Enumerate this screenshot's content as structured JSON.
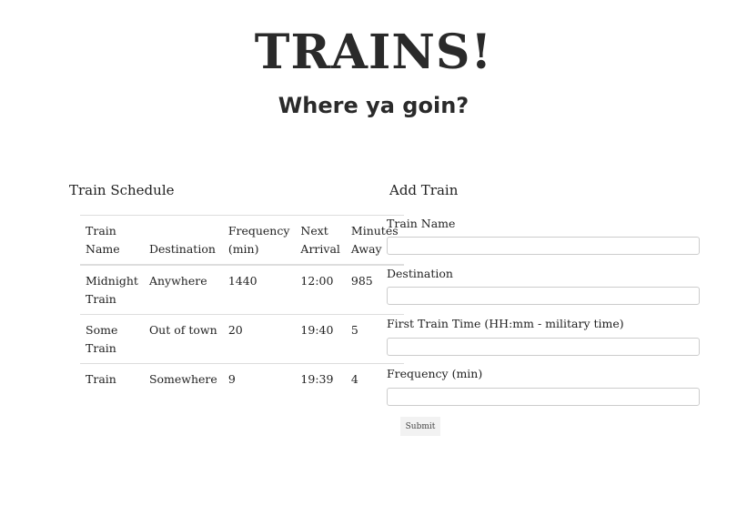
{
  "header": {
    "title": "TRAINS!",
    "subtitle": "Where ya goin?"
  },
  "schedule": {
    "heading": "Train Schedule",
    "columns": [
      "Train Name",
      "Destination",
      "Frequency (min)",
      "Next Arrival",
      "Minutes Away"
    ],
    "rows": [
      [
        "Midnight Train",
        "Anywhere",
        "1440",
        "12:00",
        "985"
      ],
      [
        "Some Train",
        "Out of town",
        "20",
        "19:40",
        "5"
      ],
      [
        "Train",
        "Somewhere",
        "9",
        "19:39",
        "4"
      ]
    ]
  },
  "form": {
    "heading": "Add Train",
    "fields": [
      {
        "label": "Train Name",
        "value": ""
      },
      {
        "label": "Destination",
        "value": ""
      },
      {
        "label": "First Train Time (HH:mm - military time)",
        "value": ""
      },
      {
        "label": "Frequency (min)",
        "value": ""
      }
    ],
    "submit_label": "Submit"
  }
}
